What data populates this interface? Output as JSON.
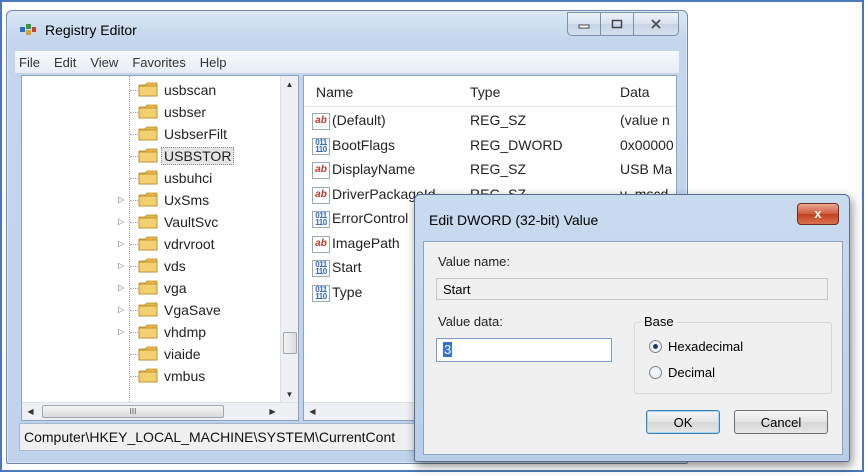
{
  "app": {
    "title": "Registry Editor",
    "menu": [
      "File",
      "Edit",
      "View",
      "Favorites",
      "Help"
    ]
  },
  "tree": {
    "items": [
      {
        "label": "usbscan",
        "expandable": false
      },
      {
        "label": "usbser",
        "expandable": false
      },
      {
        "label": "UsbserFilt",
        "expandable": false
      },
      {
        "label": "USBSTOR",
        "expandable": false,
        "selected": true
      },
      {
        "label": "usbuhci",
        "expandable": false
      },
      {
        "label": "UxSms",
        "expandable": true
      },
      {
        "label": "VaultSvc",
        "expandable": true
      },
      {
        "label": "vdrvroot",
        "expandable": true
      },
      {
        "label": "vds",
        "expandable": true
      },
      {
        "label": "vga",
        "expandable": true
      },
      {
        "label": "VgaSave",
        "expandable": true
      },
      {
        "label": "vhdmp",
        "expandable": true
      },
      {
        "label": "viaide",
        "expandable": false
      },
      {
        "label": "vmbus",
        "expandable": false
      }
    ],
    "hscroll_glyph": "III"
  },
  "values": {
    "columns": {
      "name": "Name",
      "type": "Type",
      "data": "Data"
    },
    "rows": [
      {
        "icon": "string-value-icon",
        "name": "(Default)",
        "type": "REG_SZ",
        "data": "(value n"
      },
      {
        "icon": "dword-value-icon",
        "name": "BootFlags",
        "type": "REG_DWORD",
        "data": "0x00000"
      },
      {
        "icon": "string-value-icon",
        "name": "DisplayName",
        "type": "REG_SZ",
        "data": "USB Ma"
      },
      {
        "icon": "string-value-icon",
        "name": "DriverPackageId",
        "type": "REG_SZ",
        "data": "v_mscd"
      },
      {
        "icon": "dword-value-icon",
        "name": "ErrorControl",
        "type": "",
        "data": ""
      },
      {
        "icon": "string-value-icon",
        "name": "ImagePath",
        "type": "",
        "data": ""
      },
      {
        "icon": "dword-value-icon",
        "name": "Start",
        "type": "",
        "data": ""
      },
      {
        "icon": "dword-value-icon",
        "name": "Type",
        "type": "",
        "data": ""
      }
    ]
  },
  "statusbar": {
    "path": "Computer\\HKEY_LOCAL_MACHINE\\SYSTEM\\CurrentCont"
  },
  "dialog": {
    "title": "Edit DWORD (32-bit) Value",
    "close_glyph": "x",
    "value_name_label": "Value name:",
    "value_name": "Start",
    "value_data_label": "Value data:",
    "value_data": "3",
    "base_label": "Base",
    "base_options": [
      {
        "label": "Hexadecimal",
        "selected": true
      },
      {
        "label": "Decimal",
        "selected": false
      }
    ],
    "ok_label": "OK",
    "cancel_label": "Cancel"
  },
  "colors": {
    "frame_border": "#4a78b8",
    "window_chrome": "#c3d6ee",
    "close_button": "#c2411f",
    "selection": "#3074d0"
  }
}
